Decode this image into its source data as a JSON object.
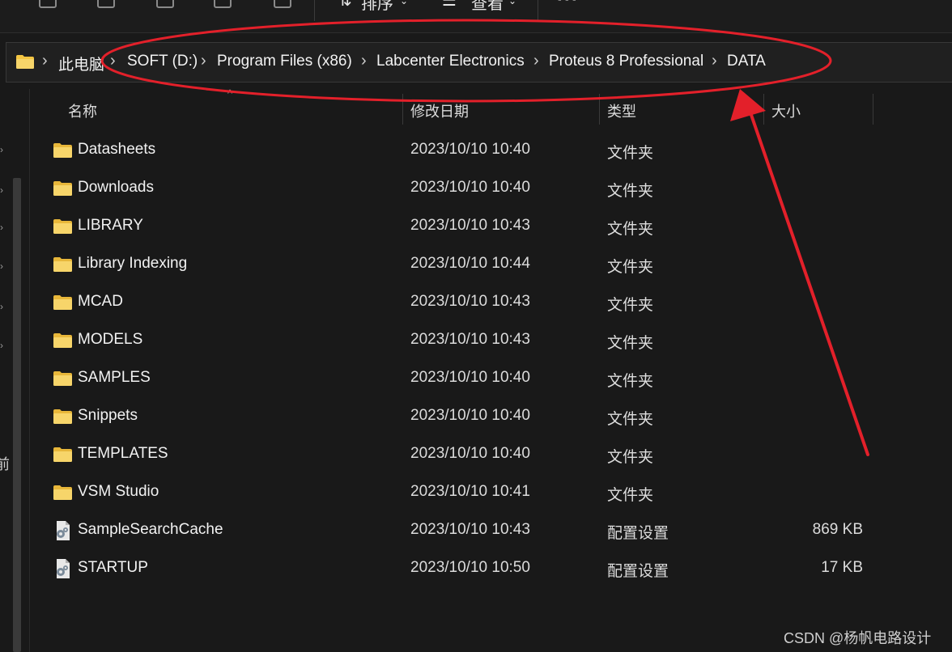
{
  "toolbar": {
    "sort_label": "排序",
    "view_label": "查看",
    "more_label": "···"
  },
  "breadcrumb": [
    "此电脑",
    "SOFT (D:)",
    "Program Files (x86)",
    "Labcenter Electronics",
    "Proteus 8 Professional",
    "DATA"
  ],
  "columns": {
    "name": "名称",
    "date": "修改日期",
    "type": "类型",
    "size": "大小"
  },
  "files": [
    {
      "name": "Datasheets",
      "date": "2023/10/10 10:40",
      "type": "文件夹",
      "size": "",
      "icon": "folder-icon"
    },
    {
      "name": "Downloads",
      "date": "2023/10/10 10:40",
      "type": "文件夹",
      "size": "",
      "icon": "folder-icon"
    },
    {
      "name": "LIBRARY",
      "date": "2023/10/10 10:43",
      "type": "文件夹",
      "size": "",
      "icon": "folder-icon"
    },
    {
      "name": "Library Indexing",
      "date": "2023/10/10 10:44",
      "type": "文件夹",
      "size": "",
      "icon": "folder-icon"
    },
    {
      "name": "MCAD",
      "date": "2023/10/10 10:43",
      "type": "文件夹",
      "size": "",
      "icon": "folder-icon"
    },
    {
      "name": "MODELS",
      "date": "2023/10/10 10:43",
      "type": "文件夹",
      "size": "",
      "icon": "folder-icon"
    },
    {
      "name": "SAMPLES",
      "date": "2023/10/10 10:40",
      "type": "文件夹",
      "size": "",
      "icon": "folder-icon"
    },
    {
      "name": "Snippets",
      "date": "2023/10/10 10:40",
      "type": "文件夹",
      "size": "",
      "icon": "folder-icon"
    },
    {
      "name": "TEMPLATES",
      "date": "2023/10/10 10:40",
      "type": "文件夹",
      "size": "",
      "icon": "folder-icon"
    },
    {
      "name": "VSM Studio",
      "date": "2023/10/10 10:41",
      "type": "文件夹",
      "size": "",
      "icon": "folder-icon"
    },
    {
      "name": "SampleSearchCache",
      "date": "2023/10/10 10:43",
      "type": "配置设置",
      "size": "869 KB",
      "icon": "config-file-icon"
    },
    {
      "name": "STARTUP",
      "date": "2023/10/10 10:50",
      "type": "配置设置",
      "size": "17 KB",
      "icon": "config-file-icon"
    }
  ],
  "left_pane_label": "前",
  "watermark": "CSDN @杨帆电路设计",
  "colors": {
    "background": "#191919",
    "folder_yellow": "#f4c542",
    "annotation_red": "#e3202a"
  }
}
